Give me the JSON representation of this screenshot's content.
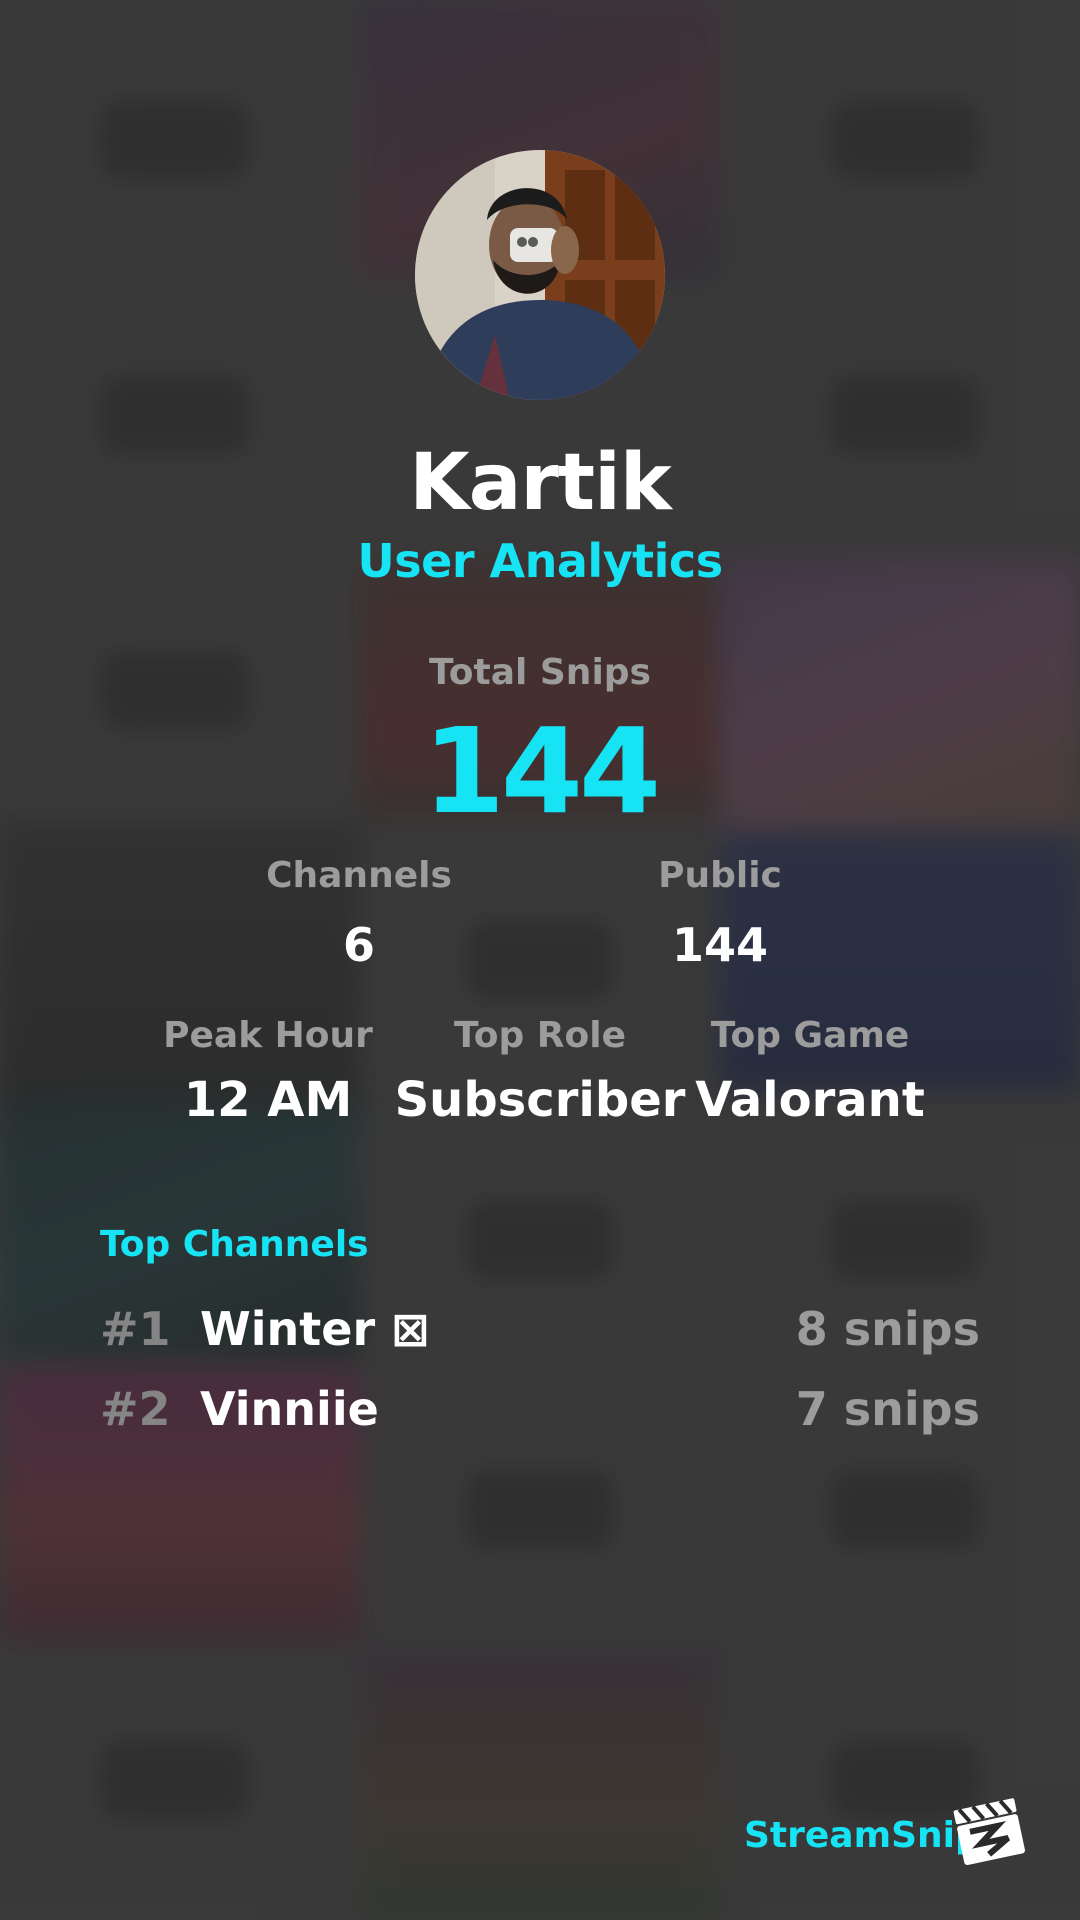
{
  "profile": {
    "name": "Kartik",
    "subtitle": "User Analytics"
  },
  "total": {
    "label": "Total Snips",
    "value": "144"
  },
  "stats_row1": {
    "channels_label": "Channels",
    "channels_value": "6",
    "public_label": "Public",
    "public_value": "144"
  },
  "stats_row2": {
    "peak_label": "Peak Hour",
    "peak_value": "12 AM",
    "role_label": "Top Role",
    "role_value": "Subscriber",
    "game_label": "Top Game",
    "game_value": "Valorant"
  },
  "top_channels": {
    "title": "Top Channels",
    "items": [
      {
        "rank": "#1",
        "name": "Winter ⊠",
        "count": "8 snips"
      },
      {
        "rank": "#2",
        "name": "Vinniie",
        "count": "7 snips"
      }
    ]
  },
  "brand": {
    "name": "StreamSnip",
    "logo_icon": "clapperboard-icon"
  },
  "colors": {
    "accent": "#16e4f5",
    "muted": "#9c9c9c",
    "background": "#3e3e3e"
  }
}
